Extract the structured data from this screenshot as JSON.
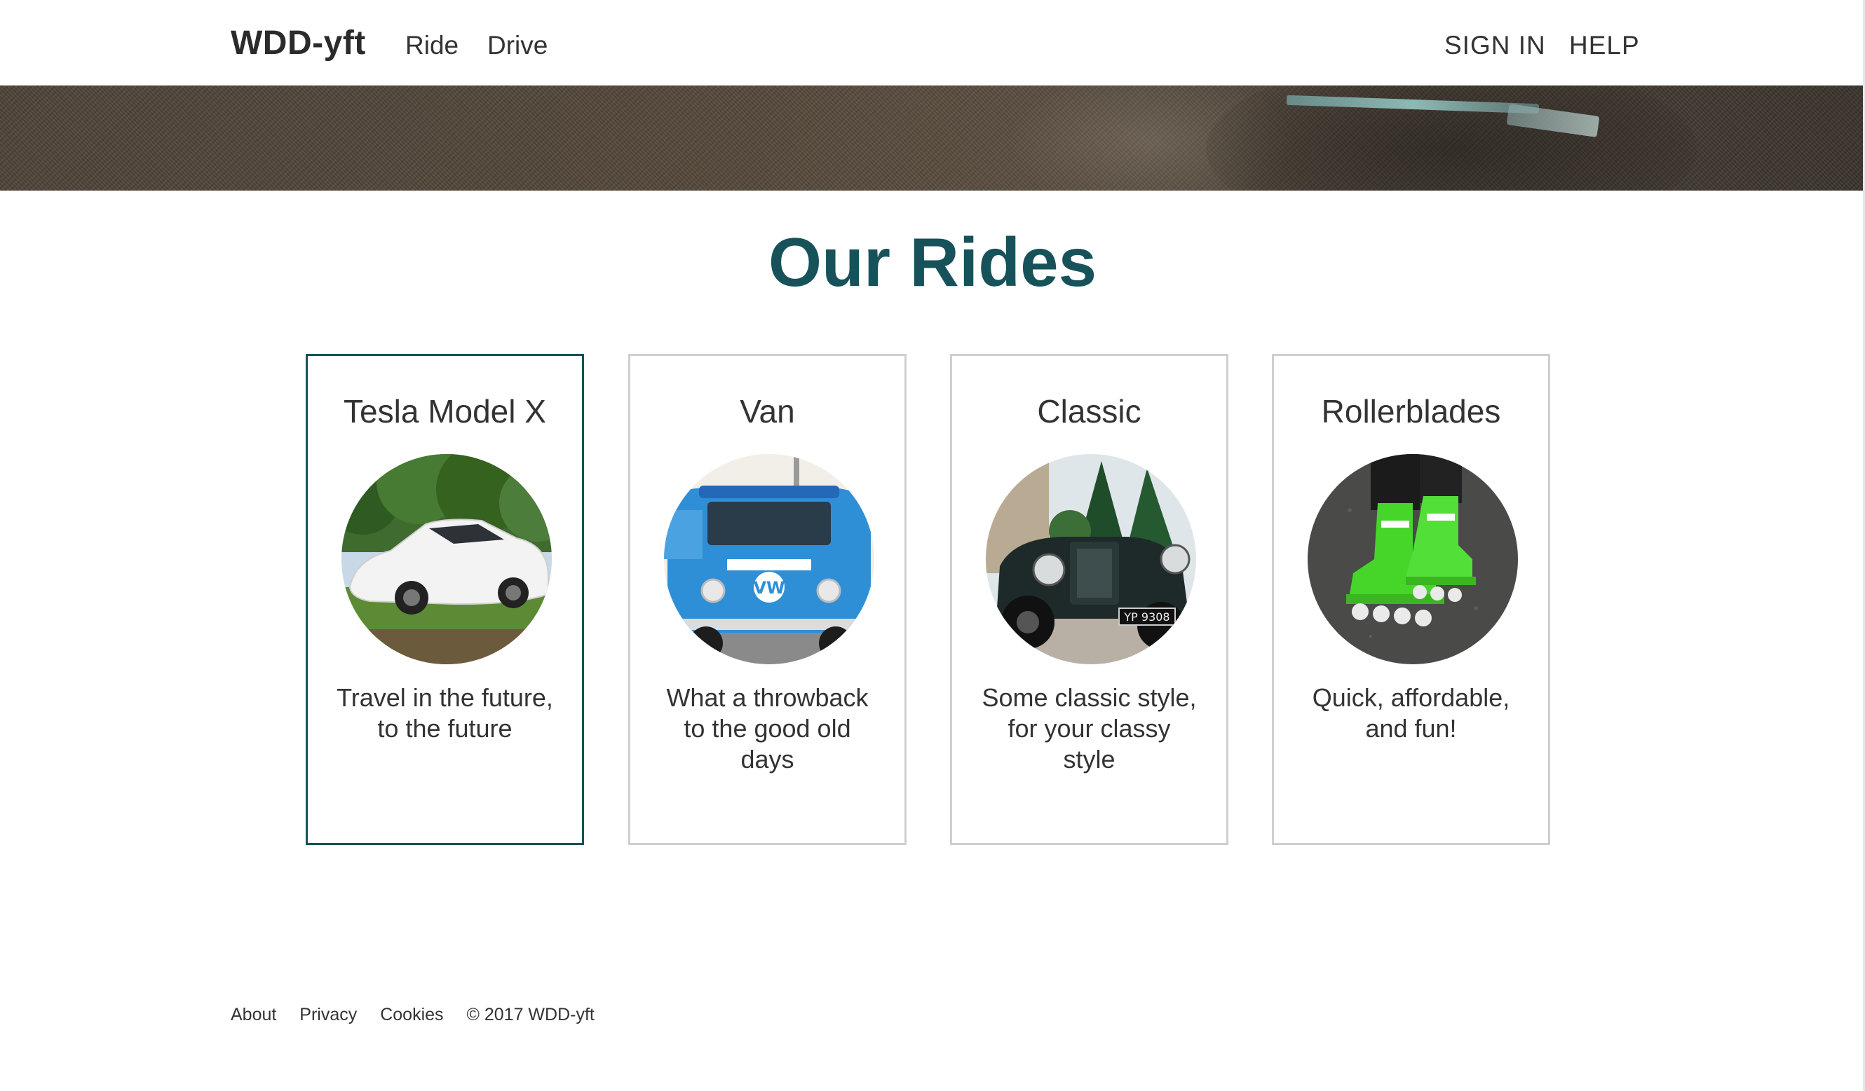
{
  "header": {
    "brand": "WDD-yft",
    "nav_left": [
      "Ride",
      "Drive"
    ],
    "nav_right": [
      "SIGN IN",
      "HELP"
    ]
  },
  "main": {
    "title": "Our Rides",
    "cards": [
      {
        "title": "Tesla Model X",
        "description": "Travel in the future, to the future",
        "image": "white-tesla-car-photo",
        "selected": true
      },
      {
        "title": "Van",
        "description": "What a throwback to the good old days",
        "image": "blue-vw-van-photo",
        "selected": false
      },
      {
        "title": "Classic",
        "description": "Some classic style, for your classy style",
        "image": "vintage-black-car-photo",
        "selected": false
      },
      {
        "title": "Rollerblades",
        "description": "Quick, affordable, and fun!",
        "image": "green-rollerblades-photo",
        "selected": false
      }
    ]
  },
  "footer": {
    "links": [
      "About",
      "Privacy",
      "Cookies"
    ],
    "copyright": "© 2017 WDD-yft"
  },
  "colors": {
    "accent": "#17525a",
    "card_border": "#cfcfcf",
    "text": "#333333"
  }
}
